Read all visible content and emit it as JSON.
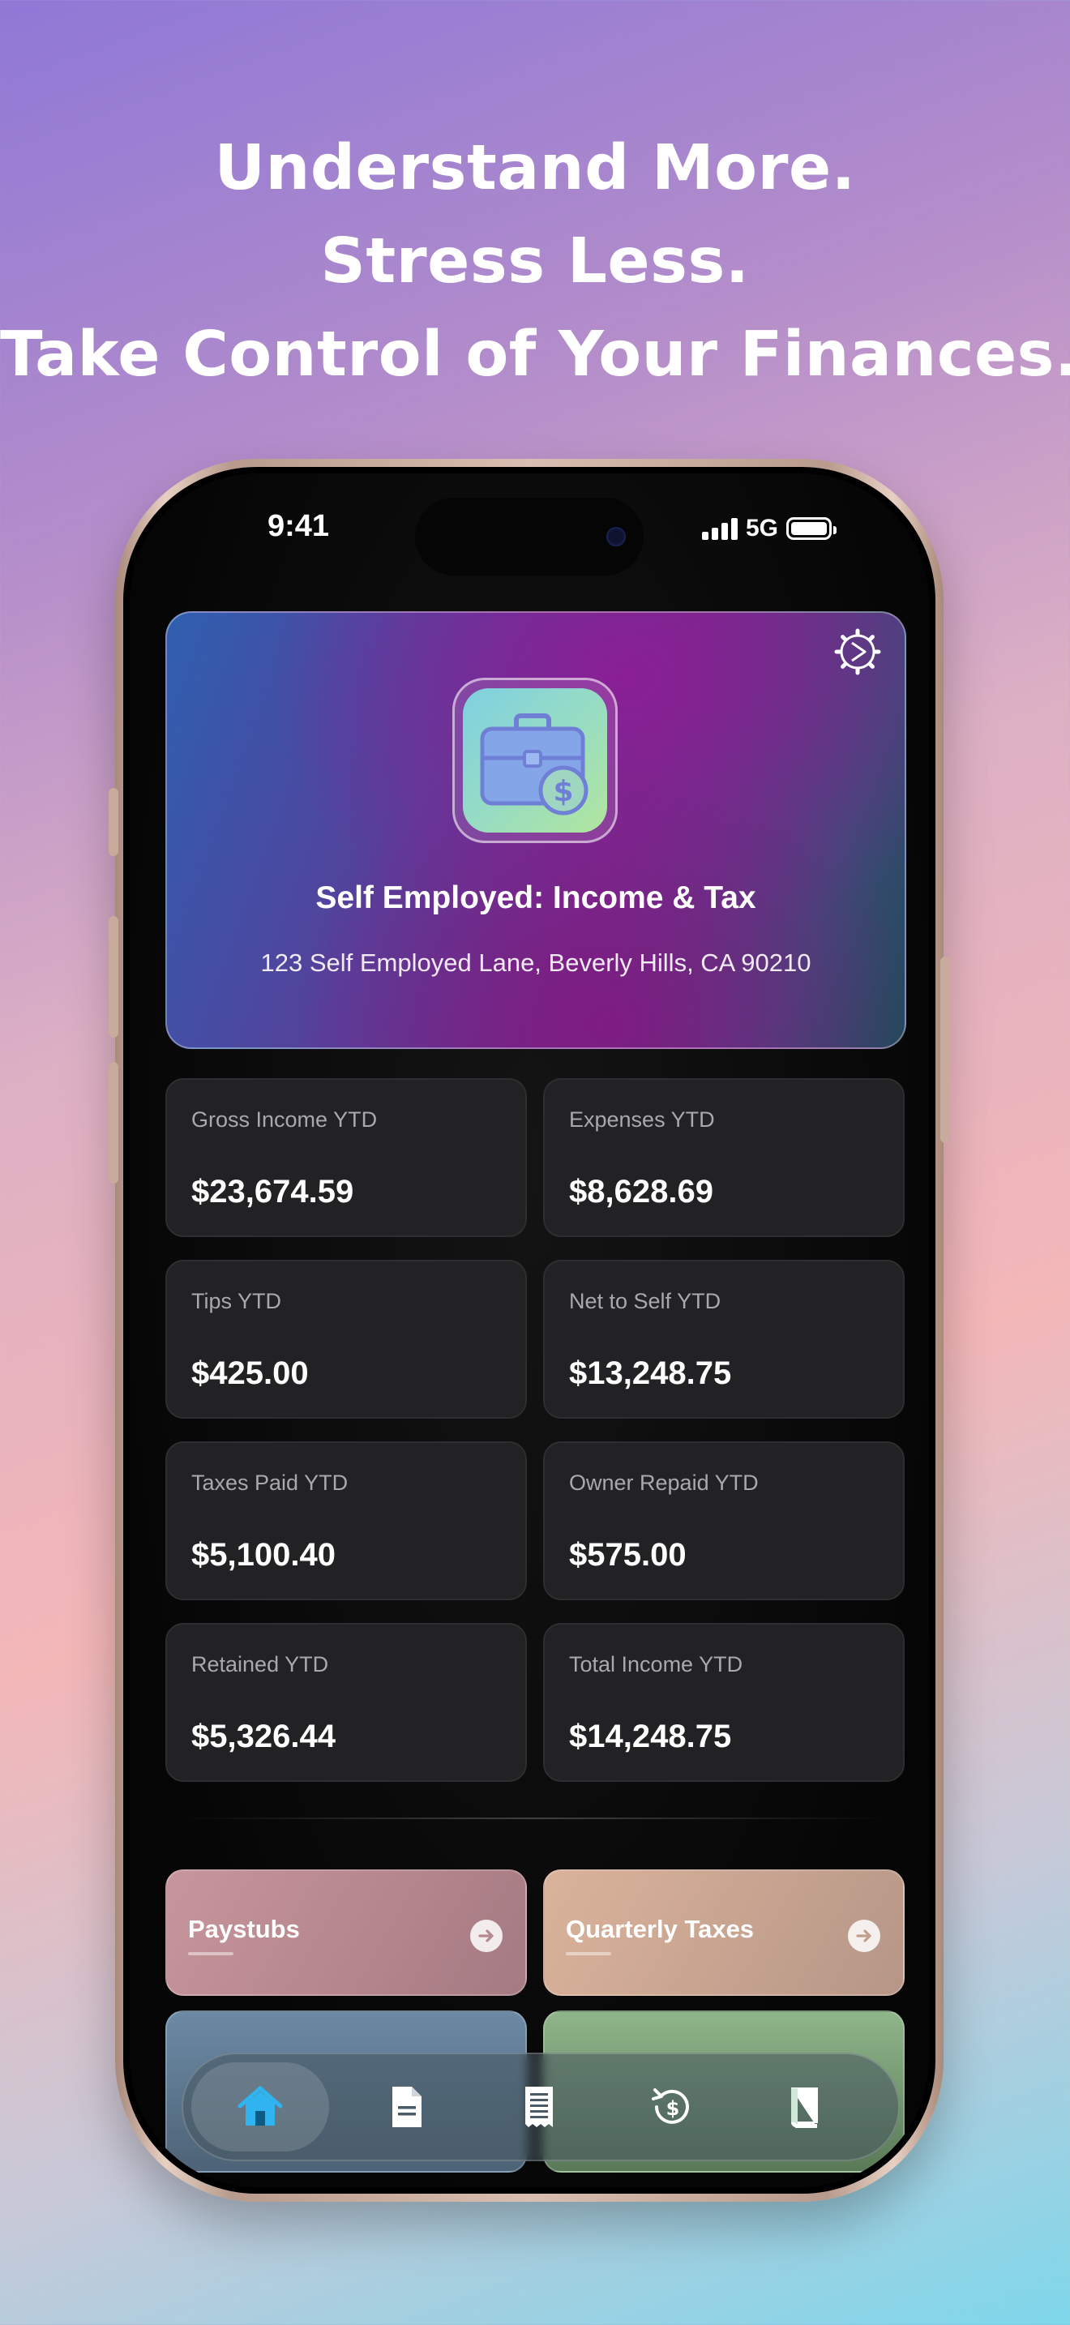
{
  "headline": {
    "line1": "Understand More.",
    "line2": "Stress Less.",
    "line3": "Take Control of Your Finances."
  },
  "status_bar": {
    "time": "9:41",
    "network": "5G",
    "battery_level": 1.0
  },
  "hero": {
    "app_name": "Self Employed: Income & Tax",
    "address": "123 Self Employed Lane, Beverly Hills, CA 90210",
    "icon": "briefcase-dollar-icon",
    "settings_icon": "gear-icon"
  },
  "stats": [
    {
      "label": "Gross Income YTD",
      "value": "$23,674.59"
    },
    {
      "label": "Expenses YTD",
      "value": "$8,628.69"
    },
    {
      "label": "Tips YTD",
      "value": "$425.00"
    },
    {
      "label": "Net to Self YTD",
      "value": "$13,248.75"
    },
    {
      "label": "Taxes Paid YTD",
      "value": "$5,100.40"
    },
    {
      "label": "Owner Repaid YTD",
      "value": "$575.00"
    },
    {
      "label": "Retained YTD",
      "value": "$5,326.44"
    },
    {
      "label": "Total Income YTD",
      "value": "$14,248.75"
    }
  ],
  "actions": [
    {
      "label": "Paystubs",
      "icon": "arrow-right-icon"
    },
    {
      "label": "Quarterly Taxes",
      "icon": "arrow-right-icon"
    }
  ],
  "tabbar": {
    "items": [
      {
        "icon": "home-icon",
        "active": true
      },
      {
        "icon": "document-icon",
        "active": false
      },
      {
        "icon": "receipt-icon",
        "active": false
      },
      {
        "icon": "refund-icon",
        "active": false
      },
      {
        "icon": "book-icon",
        "active": false
      }
    ]
  },
  "colors": {
    "accent": "#2fb4f0",
    "card_bg": "#222224",
    "label": "#a9a9ad"
  }
}
